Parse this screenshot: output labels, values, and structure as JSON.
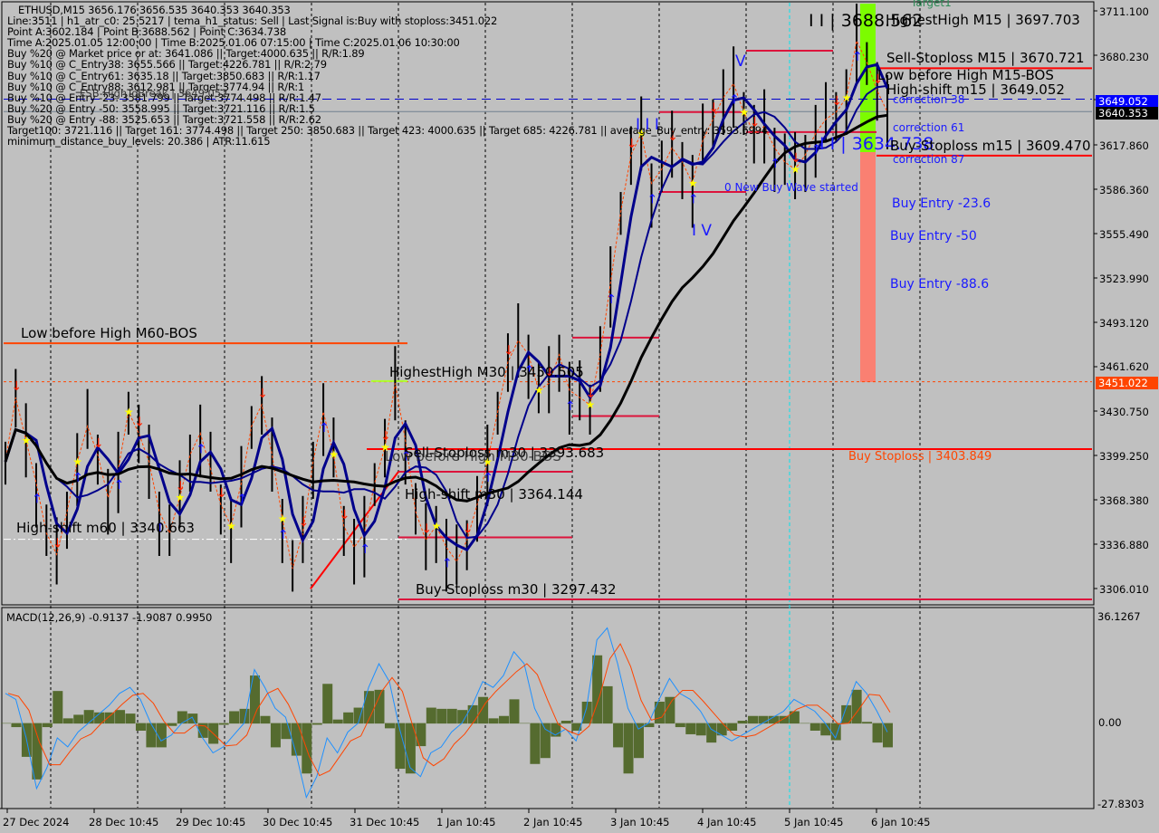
{
  "header": {
    "symbol_line": "ETHUSD,M15  3656.176 3656.535 3640.353 3640.353",
    "info_lines": [
      "Line:3511 | h1_atr_c0: 25.5217 | tema_h1_status: Sell | Last Signal is:Buy with stoploss:3451.022",
      "Point A:3602.184 | Point B:3688.562 | Point C:3634.738",
      "Time A:2025.01.05 12:00:00 | Time B:2025.01.06 07:15:00 | Time C:2025.01.06 10:30:00",
      "Buy %20 @ Market price or at: 3641.086 || Target:4000.635 || R/R:1.89",
      "Buy %10 @ C_Entry38: 3655.566 || Target:4226.781 || R/R:2.79",
      "Buy %10 @ C_Entry61: 3635.18 || Target:3850.683 || R/R:1.17",
      "Buy %10 @ C_Entry88: 3612.981 || Target:3774.94 || R/R:1",
      "Buy %10 @ Entry -23: 3581.799 || Target:3774.498 || R/R:1.47",
      "Buy %20 @ Entry -50: 3558.995 || Target:3721.116 || R/R:1.5",
      "Buy %20 @ Entry -88: 3525.653 || Target:3721.558 || R/R:2.62",
      "Target100: 3721.116 || Target 161: 3774.498 || Target 250: 3850.683 || Target 423: 4000.635 || Target 685: 4226.781 || average_Buy_entry: 3593.6994",
      "minimum_distance_buy_levels: 20.386 | ATR:11.615"
    ],
    "overlay_fsb": "FSB-HighToBreak | 3649.052"
  },
  "chart_data": {
    "type": "line",
    "title": "ETHUSD,M15",
    "ohlc_last": {
      "open": 3656.176,
      "high": 3656.535,
      "low": 3640.353,
      "close": 3640.353
    },
    "ylim": [
      3296,
      3716
    ],
    "y_ticks": [
      "3711.100",
      "3680.230",
      "3649.052",
      "3617.860",
      "3586.360",
      "3555.490",
      "3523.990",
      "3493.120",
      "3461.620",
      "3430.750",
      "3399.250",
      "3368.380",
      "3336.880",
      "3306.010"
    ],
    "x_ticks": [
      "27 Dec 2024",
      "28 Dec 10:45",
      "29 Dec 10:45",
      "30 Dec 10:45",
      "31 Dec 10:45",
      "1 Jan 10:45",
      "2 Jan 10:45",
      "3 Jan 10:45",
      "4 Jan 10:45",
      "5 Jan 10:45",
      "6 Jan 10:45"
    ],
    "price_tags": [
      {
        "value": "3649.052",
        "color": "#0000ff",
        "text_color": "#ffffff"
      },
      {
        "value": "3640.353",
        "color": "#000000",
        "text_color": "#ffffff"
      },
      {
        "value": "3451.022",
        "color": "#ff4500",
        "text_color": "#ffffff"
      }
    ],
    "price_series": [
      3395,
      3440,
      3410,
      3380,
      3345,
      3330,
      3360,
      3395,
      3420,
      3400,
      3370,
      3390,
      3430,
      3415,
      3395,
      3360,
      3345,
      3370,
      3400,
      3415,
      3390,
      3365,
      3350,
      3380,
      3420,
      3435,
      3400,
      3355,
      3320,
      3345,
      3395,
      3430,
      3400,
      3350,
      3335,
      3345,
      3380,
      3405,
      3450,
      3410,
      3360,
      3340,
      3350,
      3335,
      3325,
      3340,
      3365,
      3395,
      3430,
      3465,
      3480,
      3470,
      3445,
      3450,
      3470,
      3445,
      3440,
      3435,
      3470,
      3520,
      3570,
      3610,
      3625,
      3590,
      3600,
      3615,
      3605,
      3590,
      3620,
      3635,
      3650,
      3660,
      3640,
      3625,
      3630,
      3615,
      3605,
      3600,
      3610,
      3625,
      3635,
      3640,
      3650,
      3690,
      3675,
      3655,
      3640
    ],
    "levels": [
      {
        "label": "HighestHigh   M15 | 3697.703",
        "value": 3697.703,
        "color": "#000000"
      },
      {
        "label": "Sell-Stoploss M15 | 3670.721",
        "value": 3670.721,
        "color": "#ff0000"
      },
      {
        "label": "Low before High   M15-BOS",
        "value": 3662,
        "color": "#dc143c"
      },
      {
        "label": "High-shift m15 | 3649.052",
        "value": 3649.052,
        "color": "#0000ff"
      },
      {
        "label": "Buy-Stoploss m15 | 3609.470",
        "value": 3609.47,
        "color": "#ff0000"
      },
      {
        "label": "Low before High   M60-BOS",
        "value": 3478,
        "color": "#ff4500"
      },
      {
        "label": "HighestHigh   M30 | 3450.505",
        "value": 3450.505,
        "color": "#adff2f"
      },
      {
        "label": "Sell-Stoploss m30 | 3393.683",
        "value": 3393.683,
        "color": "#ff0000"
      },
      {
        "label": "Low before High   M30-BOS",
        "value": 3390,
        "color": "#dc143c"
      },
      {
        "label": "High-shift m30 | 3364.144",
        "value": 3364.144,
        "color": "#dc143c"
      },
      {
        "label": "High-shift m60 | 3340.663",
        "value": 3340.663,
        "color": "#ffffff"
      },
      {
        "label": "Buy-Stoploss m30 | 3297.432",
        "value": 3297.432,
        "color": "#dc143c"
      },
      {
        "label": "Buy Stoploss | 3403.849",
        "value": 3403.849,
        "color": "#ff0000"
      }
    ],
    "wave_labels": [
      "I I | 3688.562",
      "I I | 3634.738",
      "V",
      "I V",
      "I I I",
      "0 New Buy Wave started"
    ],
    "correction_labels": [
      "correction 38",
      "correction 61",
      "correction 87"
    ],
    "entry_labels": [
      "Buy Entry -23.6",
      "Buy Entry -50",
      "Buy Entry -88.6"
    ],
    "target_label": "Target1",
    "macd": {
      "title": "MACD(12,26,9) -0.9137 -1.9087 0.9950",
      "params": "12,26,9",
      "values": [
        -0.9137,
        -1.9087,
        0.995
      ],
      "ylim": [
        -27.8303,
        36.1267
      ],
      "y_ticks": [
        "36.1267",
        "0.00",
        "-27.8303"
      ],
      "main_series": [
        10,
        8,
        -5,
        -22,
        -15,
        -5,
        -8,
        -3,
        0,
        3,
        6,
        10,
        12,
        8,
        0,
        -6,
        -4,
        0,
        2,
        -5,
        -10,
        -8,
        -4,
        0,
        18,
        12,
        5,
        2,
        -10,
        -25,
        -18,
        -5,
        -10,
        -3,
        0,
        12,
        20,
        14,
        -2,
        -15,
        -18,
        -10,
        -8,
        -3,
        0,
        6,
        14,
        12,
        16,
        24,
        20,
        5,
        -2,
        -4,
        -2,
        -6,
        5,
        28,
        32,
        20,
        5,
        -2,
        0,
        8,
        15,
        10,
        8,
        4,
        -2,
        -4,
        -6,
        -4,
        -2,
        0,
        2,
        4,
        8,
        6,
        4,
        0,
        -5,
        5,
        14,
        10,
        4,
        -3
      ]
    }
  },
  "colors": {
    "background": "#c0c0c0",
    "ma_fast": "#00008b",
    "ma_slow": "#000000",
    "level_red": "#ff0000",
    "fib_green": "#7cfc00",
    "fib_salmon": "#fa8072",
    "macd_hist": "#556b2f",
    "macd_main": "#1e90ff",
    "macd_signal": "#ff4500"
  }
}
